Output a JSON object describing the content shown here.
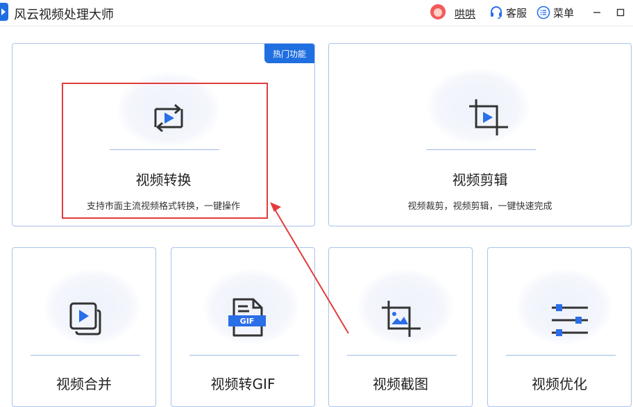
{
  "app": {
    "title": "风云视频处理大师"
  },
  "header": {
    "user_name": "哄哄",
    "service_label": "客服",
    "menu_label": "菜单"
  },
  "cards": {
    "convert": {
      "title": "视频转换",
      "desc": "支持市面主流视频格式转换，一键操作",
      "badge": "热门功能",
      "icon": "convert-icon"
    },
    "edit": {
      "title": "视频剪辑",
      "desc": "视频裁剪，视频剪辑，一键快速完成",
      "icon": "crop-icon"
    },
    "merge": {
      "title": "视频合并",
      "icon": "merge-icon"
    },
    "to_gif": {
      "title": "视频转GIF",
      "icon": "gif-file-icon",
      "gif_label": "GIF"
    },
    "screenshot": {
      "title": "视频截图",
      "icon": "crop-image-icon"
    },
    "optimize": {
      "title": "视频优化",
      "icon": "sliders-icon"
    }
  },
  "colors": {
    "brand": "#1f6fe0",
    "card_border": "#a9c3ea",
    "icon_dark": "#333333",
    "icon_blue": "#2a6ee8",
    "annotation_red": "#e23b3b"
  }
}
